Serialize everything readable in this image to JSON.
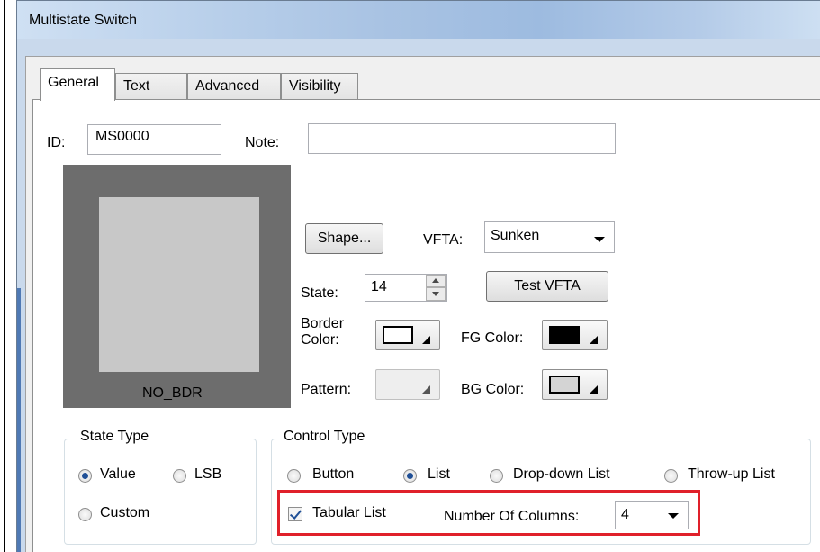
{
  "window": {
    "title": "Multistate Switch"
  },
  "tabs": [
    {
      "label": "General",
      "active": true
    },
    {
      "label": "Text"
    },
    {
      "label": "Advanced"
    },
    {
      "label": "Visibility"
    }
  ],
  "general": {
    "id_label": "ID:",
    "id_value": "MS0000",
    "note_label": "Note:",
    "note_value": "",
    "preview_caption": "NO_BDR",
    "shape_button": "Shape...",
    "vfta_label": "VFTA:",
    "vfta_value": "Sunken",
    "state_label": "State:",
    "state_value": "14",
    "test_vfta_button": "Test VFTA",
    "border_color_label": "Border\nColor:",
    "fg_color_label": "FG Color:",
    "pattern_label": "Pattern:",
    "bg_color_label": "BG Color:"
  },
  "state_type": {
    "title": "State Type",
    "options": [
      "Value",
      "LSB",
      "Custom"
    ],
    "selected": "Value"
  },
  "control_type": {
    "title": "Control Type",
    "options": [
      "Button",
      "List",
      "Drop-down List",
      "Throw-up List"
    ],
    "selected": "List",
    "tabular_list_label": "Tabular List",
    "tabular_list_checked": true,
    "columns_label": "Number Of Columns:",
    "columns_value": "4"
  },
  "colors": {
    "highlight": "#e0202a",
    "fg_swatch": "#000000",
    "bg_swatch": "#d4d4d4",
    "border_swatch": "#ffffff"
  }
}
